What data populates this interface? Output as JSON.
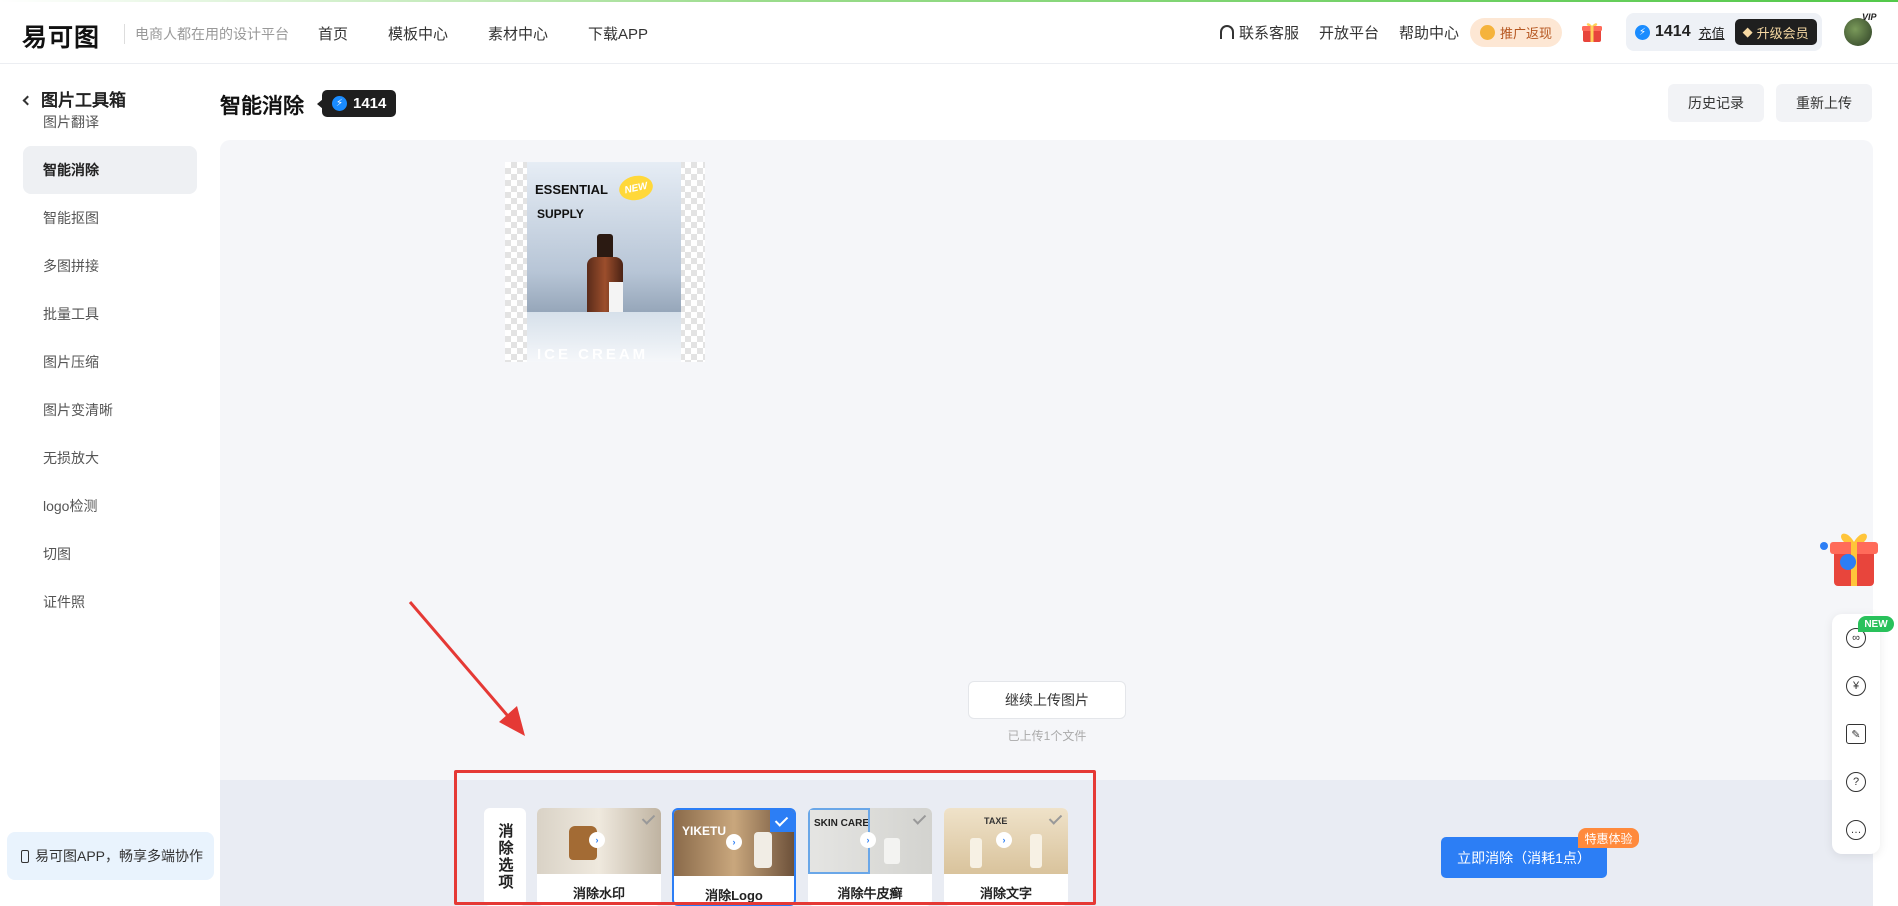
{
  "header": {
    "logo": "易可图",
    "slogan": "电商人都在用的设计平台",
    "nav": [
      "首页",
      "模板中心",
      "素材中心",
      "下载APP"
    ],
    "right_links": [
      "联系客服",
      "开放平台",
      "帮助中心"
    ],
    "promo": "推广返现",
    "credits": "1414",
    "recharge": "充值",
    "upgrade": "升级会员",
    "vip_tag": "VIP"
  },
  "sidebar": {
    "title": "图片工具箱",
    "items": [
      "图片翻译",
      "智能消除",
      "智能抠图",
      "多图拼接",
      "批量工具",
      "图片压缩",
      "图片变清晰",
      "无损放大",
      "logo检测",
      "切图",
      "证件照"
    ],
    "active_index": 1,
    "app_promo": "易可图APP，畅享多端协作"
  },
  "main": {
    "title": "智能消除",
    "credits": "1414",
    "history_button": "历史记录",
    "reupload_button": "重新上传",
    "image_text": {
      "line1": "ESSENTIAL",
      "line2": "SUPPLY",
      "badge": "NEW",
      "footer": "ICE CREAM"
    },
    "continue_upload": "继续上传图片",
    "uploaded_count": "已上传1个文件"
  },
  "options": {
    "label": "消除选项",
    "items": [
      {
        "name": "消除水印",
        "image_text": "",
        "selected": false
      },
      {
        "name": "消除Logo",
        "image_text": "YIKETU",
        "selected": true
      },
      {
        "name": "消除牛皮癣",
        "image_text": "SKIN CARE",
        "selected": false
      },
      {
        "name": "消除文字",
        "image_text": "TAXE",
        "selected": false
      }
    ]
  },
  "action": {
    "erase_button": "立即消除（消耗1点）",
    "special_badge": "特惠体验"
  },
  "float": {
    "new_tag": "NEW",
    "icons": [
      "link-icon",
      "yuan-icon",
      "edit-icon",
      "help-icon",
      "chat-icon"
    ]
  },
  "colors": {
    "primary": "#2c7ef5",
    "highlight_red": "#e53935",
    "badge_orange": "#ff8a3c",
    "new_green": "#29c15b"
  }
}
